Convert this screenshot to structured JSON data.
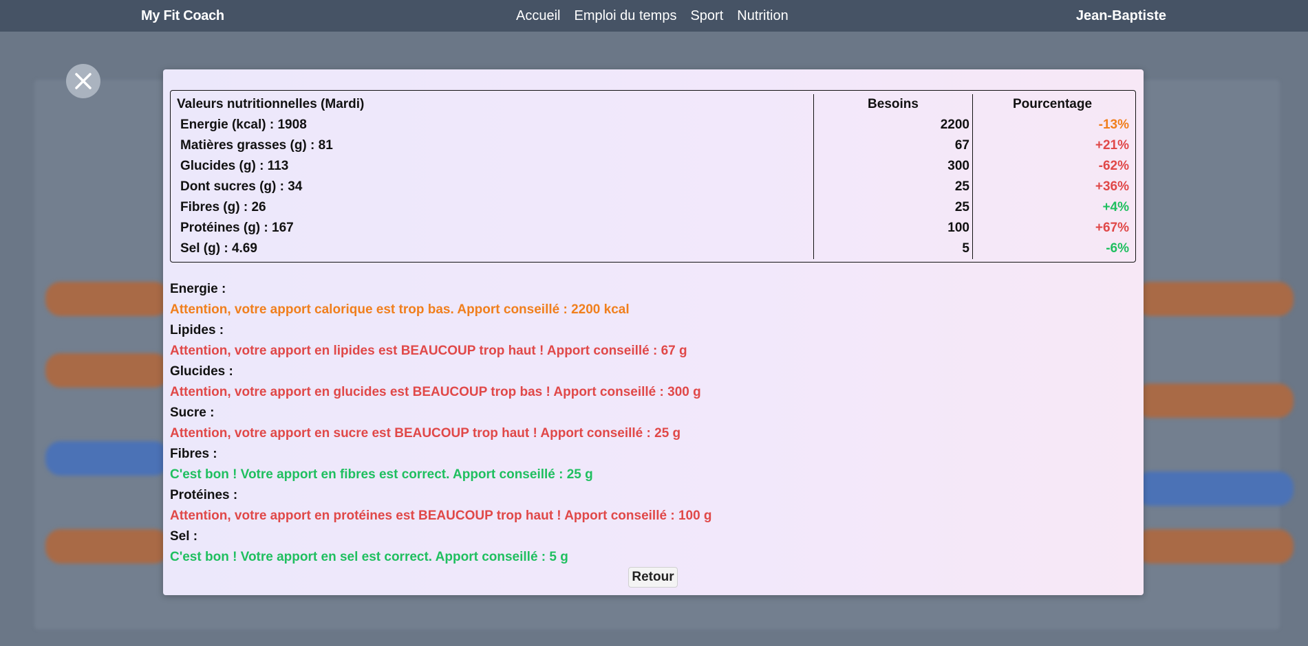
{
  "navbar": {
    "brand": "My Fit Coach",
    "links": [
      "Accueil",
      "Emploi du temps",
      "Sport",
      "Nutrition"
    ],
    "user": "Jean-Baptiste"
  },
  "colors": {
    "navbar": "#465365",
    "overlay": "#6b7787",
    "orange": "#f07f1d",
    "red": "#e04848",
    "green": "#1fbf5f"
  },
  "modal": {
    "table": {
      "headers": [
        "Valeurs nutritionnelles (Mardi)",
        "Besoins",
        "Pourcentage"
      ],
      "rows": [
        {
          "label": "Energie (kcal) : 1908",
          "need": "2200",
          "pct": "-13%",
          "status": "orange"
        },
        {
          "label": "Matières grasses (g) : 81",
          "need": "67",
          "pct": "+21%",
          "status": "red"
        },
        {
          "label": "Glucides (g) : 113",
          "need": "300",
          "pct": "-62%",
          "status": "red"
        },
        {
          "label": "Dont sucres (g) : 34",
          "need": "25",
          "pct": "+36%",
          "status": "red"
        },
        {
          "label": "Fibres (g) : 26",
          "need": "25",
          "pct": "+4%",
          "status": "green"
        },
        {
          "label": "Protéines (g) : 167",
          "need": "100",
          "pct": "+67%",
          "status": "red"
        },
        {
          "label": "Sel (g) : 4.69",
          "need": "5",
          "pct": "-6%",
          "status": "green"
        }
      ]
    },
    "advice": [
      {
        "heading": "Energie :",
        "message": "Attention, votre apport calorique est trop bas. Apport conseillé : 2200 kcal",
        "status": "orange"
      },
      {
        "heading": "Lipides :",
        "message": "Attention, votre apport en lipides est BEAUCOUP trop haut ! Apport conseillé : 67 g",
        "status": "red"
      },
      {
        "heading": "Glucides :",
        "message": "Attention, votre apport en glucides est BEAUCOUP trop bas ! Apport conseillé : 300 g",
        "status": "red"
      },
      {
        "heading": "Sucre :",
        "message": "Attention, votre apport en sucre est BEAUCOUP trop haut ! Apport conseillé : 25 g",
        "status": "red"
      },
      {
        "heading": "Fibres :",
        "message": "C'est bon ! Votre apport en fibres est correct. Apport conseillé : 25 g",
        "status": "green"
      },
      {
        "heading": "Protéines :",
        "message": "Attention, votre apport en protéines est BEAUCOUP trop haut ! Apport conseillé : 100 g",
        "status": "red"
      },
      {
        "heading": "Sel :",
        "message": "C'est bon ! Votre apport en sel est correct. Apport conseillé : 5 g",
        "status": "green"
      }
    ],
    "back_label": "Retour",
    "close_icon": "close-icon"
  }
}
